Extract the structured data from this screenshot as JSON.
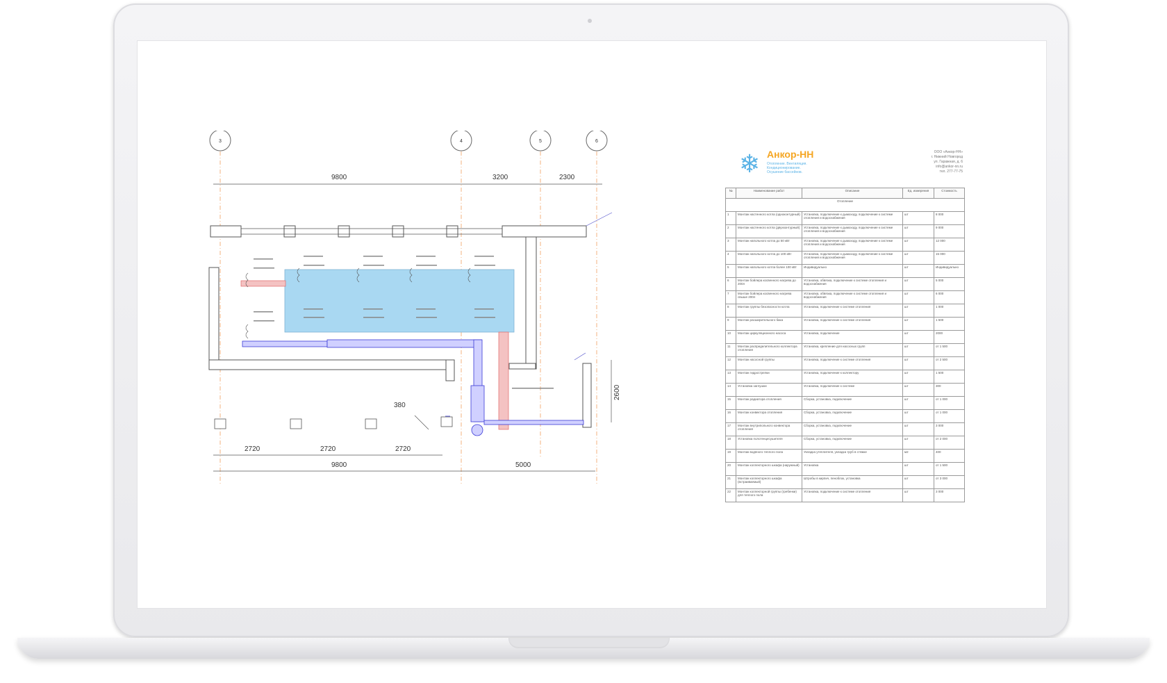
{
  "drawing": {
    "axis_labels": [
      "3",
      "4",
      "5",
      "6"
    ],
    "dims_top": [
      "9800",
      "3200",
      "2300"
    ],
    "dims_bottom": [
      "2720",
      "2720",
      "2720"
    ],
    "dims_bottom_total": [
      "9800",
      "5000"
    ],
    "dim_side": "2600",
    "dim_small": "380",
    "colors": {
      "pool": "#a9d8f2",
      "supply": "#3a3ad6",
      "return": "#e88a8a",
      "wall": "#555555",
      "axis": "#f0a060"
    }
  },
  "spec": {
    "logo_name": "Анкор-НН",
    "logo_tags": [
      "Отопление. Вентиляция.",
      "Кондиционирование.",
      "Осушение бассейнов."
    ],
    "company_lines": [
      "ООО «Анкор-НН»",
      "г. Нижний Новгород",
      "ул. Гаражная, д. 6",
      "info@ankor-nn.ru",
      "тел. 277-77-75"
    ],
    "columns": [
      "№",
      "Наименование работ",
      "Описание",
      "Ед. измерения",
      "Стоимость"
    ],
    "section": "Отопление",
    "rows": [
      {
        "n": "1",
        "name": "Монтаж настенного котла (одноконтурный)",
        "desc": "Установка, подключение к дымоходу, подключение к системе отопления и водоснабжения",
        "unit": "шт",
        "price": "8 000"
      },
      {
        "n": "2",
        "name": "Монтаж настенного котла (двухконтурный)",
        "desc": "Установка, подключение к дымоходу, подключение к системе отопления и водоснабжения",
        "unit": "шт",
        "price": "9 000"
      },
      {
        "n": "3",
        "name": "Монтаж напольного котла до 50 кВт",
        "desc": "Установка, подключение к дымоходу, подключение к системе отопления и водоснабжения",
        "unit": "шт",
        "price": "12 000"
      },
      {
        "n": "4",
        "name": "Монтаж напольного котла до 100 кВт",
        "desc": "Установка, подключение к дымоходу, подключение к системе отопления и водоснабжения",
        "unit": "шт",
        "price": "15 000"
      },
      {
        "n": "5",
        "name": "Монтаж напольного котла более 100 кВт",
        "desc": "Индивидуально",
        "unit": "шт",
        "price": "Индивидуально"
      },
      {
        "n": "6",
        "name": "Монтаж бойлера косвенного нагрева до 200л",
        "desc": "Установка, обвязка, подключение к системе отопления и водоснабжения",
        "unit": "шт",
        "price": "5 000"
      },
      {
        "n": "7",
        "name": "Монтаж бойлера косвенного нагрева свыше 200л",
        "desc": "Установка, обвязка, подключение к системе отопления и водоснабжения",
        "unit": "шт",
        "price": "6 000"
      },
      {
        "n": "8",
        "name": "Монтаж группы безопасности котла",
        "desc": "Установка, подключение к системе отопления",
        "unit": "шт",
        "price": "1 000"
      },
      {
        "n": "9",
        "name": "Монтаж расширительного бака",
        "desc": "Установка, подключение к системе отопления",
        "unit": "шт",
        "price": "1 500"
      },
      {
        "n": "10",
        "name": "Монтаж циркуляционного насоса",
        "desc": "Установка, подключение",
        "unit": "шт",
        "price": "2000"
      },
      {
        "n": "11",
        "name": "Монтаж распределительного коллектора отопления",
        "desc": "Установка, крепление для насосных групп",
        "unit": "шт",
        "price": "от 1 500"
      },
      {
        "n": "12",
        "name": "Монтаж насосной группы",
        "desc": "Установка, подключение к системе отопления",
        "unit": "шт",
        "price": "от 2 500"
      },
      {
        "n": "13",
        "name": "Монтаж гидрострелки",
        "desc": "Установка, подключение к коллектору",
        "unit": "шт",
        "price": "1 500"
      },
      {
        "n": "14",
        "name": "Установка заглушки",
        "desc": "Установка, подключение к системе",
        "unit": "шт",
        "price": "300"
      },
      {
        "n": "15",
        "name": "Монтаж радиатора отопления",
        "desc": "Сборка, установка, подключение",
        "unit": "шт",
        "price": "от 1 000"
      },
      {
        "n": "16",
        "name": "Монтаж конвектора отопления",
        "desc": "Сборка, установка, подключение",
        "unit": "шт",
        "price": "от 1 000"
      },
      {
        "n": "17",
        "name": "Монтаж внутрипольного конвектора отопления",
        "desc": "Сборка, установка, подключение",
        "unit": "шт",
        "price": "3 000"
      },
      {
        "n": "18",
        "name": "Установка полотенцесушителя",
        "desc": "Сборка, установка, подключение",
        "unit": "шт",
        "price": "от 2 000"
      },
      {
        "n": "19",
        "name": "Монтаж водяного теплого пола",
        "desc": "Укладка утеплителя, укладка труб в стяжке",
        "unit": "м2",
        "price": "400"
      },
      {
        "n": "20",
        "name": "Монтаж коллекторного шкафа (наружный)",
        "desc": "Установка",
        "unit": "шт",
        "price": "от 1 500"
      },
      {
        "n": "21",
        "name": "Монтаж коллекторного шкафа (встраиваемый)",
        "desc": "Штробы в кирпич, пеноблок, установка",
        "unit": "шт",
        "price": "от 3 000"
      },
      {
        "n": "22",
        "name": "Монтаж коллекторной группы (гребенки) для теплого пола",
        "desc": "Установка, подключение к системе отопления",
        "unit": "шт",
        "price": "3 000"
      }
    ]
  }
}
